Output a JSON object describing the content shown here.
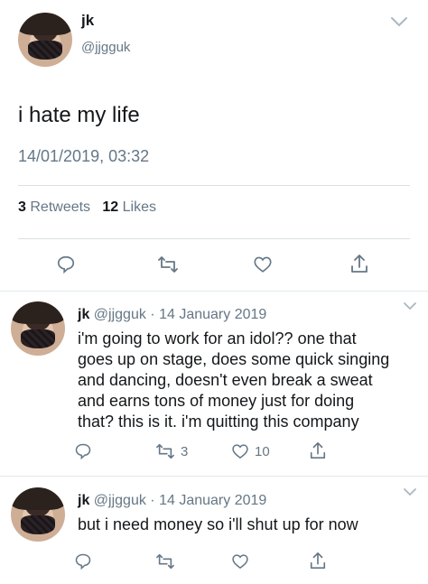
{
  "main_tweet": {
    "name": "jk",
    "handle": "@jjgguk",
    "text": "i hate my life",
    "timestamp": "14/01/2019, 03:32",
    "retweets_count": "3",
    "retweets_label": "Retweets",
    "likes_count": "12",
    "likes_label": "Likes"
  },
  "replies": [
    {
      "name": "jk",
      "handle": "@jjgguk",
      "separator": "·",
      "date": "14 January 2019",
      "text_lines": [
        "i'm going to work for an idol?? one that",
        "goes up on stage, does some quick singing",
        "and dancing, doesn't even break a sweat",
        "and earns tons of money just for doing",
        "that?  this is it. i'm quitting this company"
      ],
      "retweet_count": "3",
      "like_count": "10"
    },
    {
      "name": "jk",
      "handle": "@jjgguk",
      "separator": "·",
      "date": "14 January 2019",
      "text_lines": [
        "but i need money so i'll shut up for now"
      ]
    }
  ],
  "colors": {
    "secondary": "#657786",
    "text": "#14171a",
    "divider": "#e1e8ed"
  },
  "icons": [
    "reply-icon",
    "retweet-icon",
    "like-icon",
    "share-icon",
    "chevron-down-icon"
  ]
}
